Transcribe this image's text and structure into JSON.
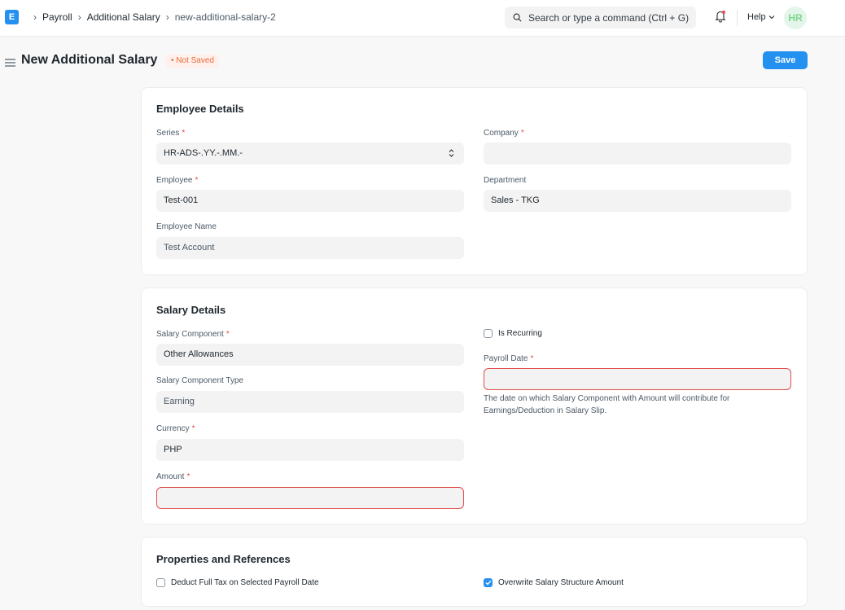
{
  "navbar": {
    "logo": "E",
    "breadcrumbs": [
      "Payroll",
      "Additional Salary",
      "new-additional-salary-2"
    ],
    "search_placeholder": "Search or type a command (Ctrl + G)",
    "help_label": "Help",
    "avatar_initials": "HR"
  },
  "page": {
    "title": "New Additional Salary",
    "status": "Not Saved",
    "save_label": "Save"
  },
  "employee_details": {
    "title": "Employee Details",
    "series_label": "Series",
    "series_value": "HR-ADS-.YY.-.MM.-",
    "company_label": "Company",
    "company_value": "",
    "employee_label": "Employee",
    "employee_value": "Test-001",
    "department_label": "Department",
    "department_value": "Sales - TKG",
    "employee_name_label": "Employee Name",
    "employee_name_value": "Test Account"
  },
  "salary_details": {
    "title": "Salary Details",
    "component_label": "Salary Component",
    "component_value": "Other Allowances",
    "is_recurring_label": "Is Recurring",
    "is_recurring_checked": false,
    "payroll_date_label": "Payroll Date",
    "payroll_date_value": "",
    "payroll_date_help": "The date on which Salary Component with Amount will contribute for Earnings/Deduction in Salary Slip.",
    "component_type_label": "Salary Component Type",
    "component_type_value": "Earning",
    "currency_label": "Currency",
    "currency_value": "PHP",
    "amount_label": "Amount",
    "amount_value": ""
  },
  "properties": {
    "title": "Properties and References",
    "deduct_full_tax_label": "Deduct Full Tax on Selected Payroll Date",
    "deduct_full_tax_checked": false,
    "overwrite_label": "Overwrite Salary Structure Amount",
    "overwrite_checked": true
  },
  "colors": {
    "primary": "#2490ef",
    "required": "#e24c4c",
    "status": "#e86c3c"
  }
}
